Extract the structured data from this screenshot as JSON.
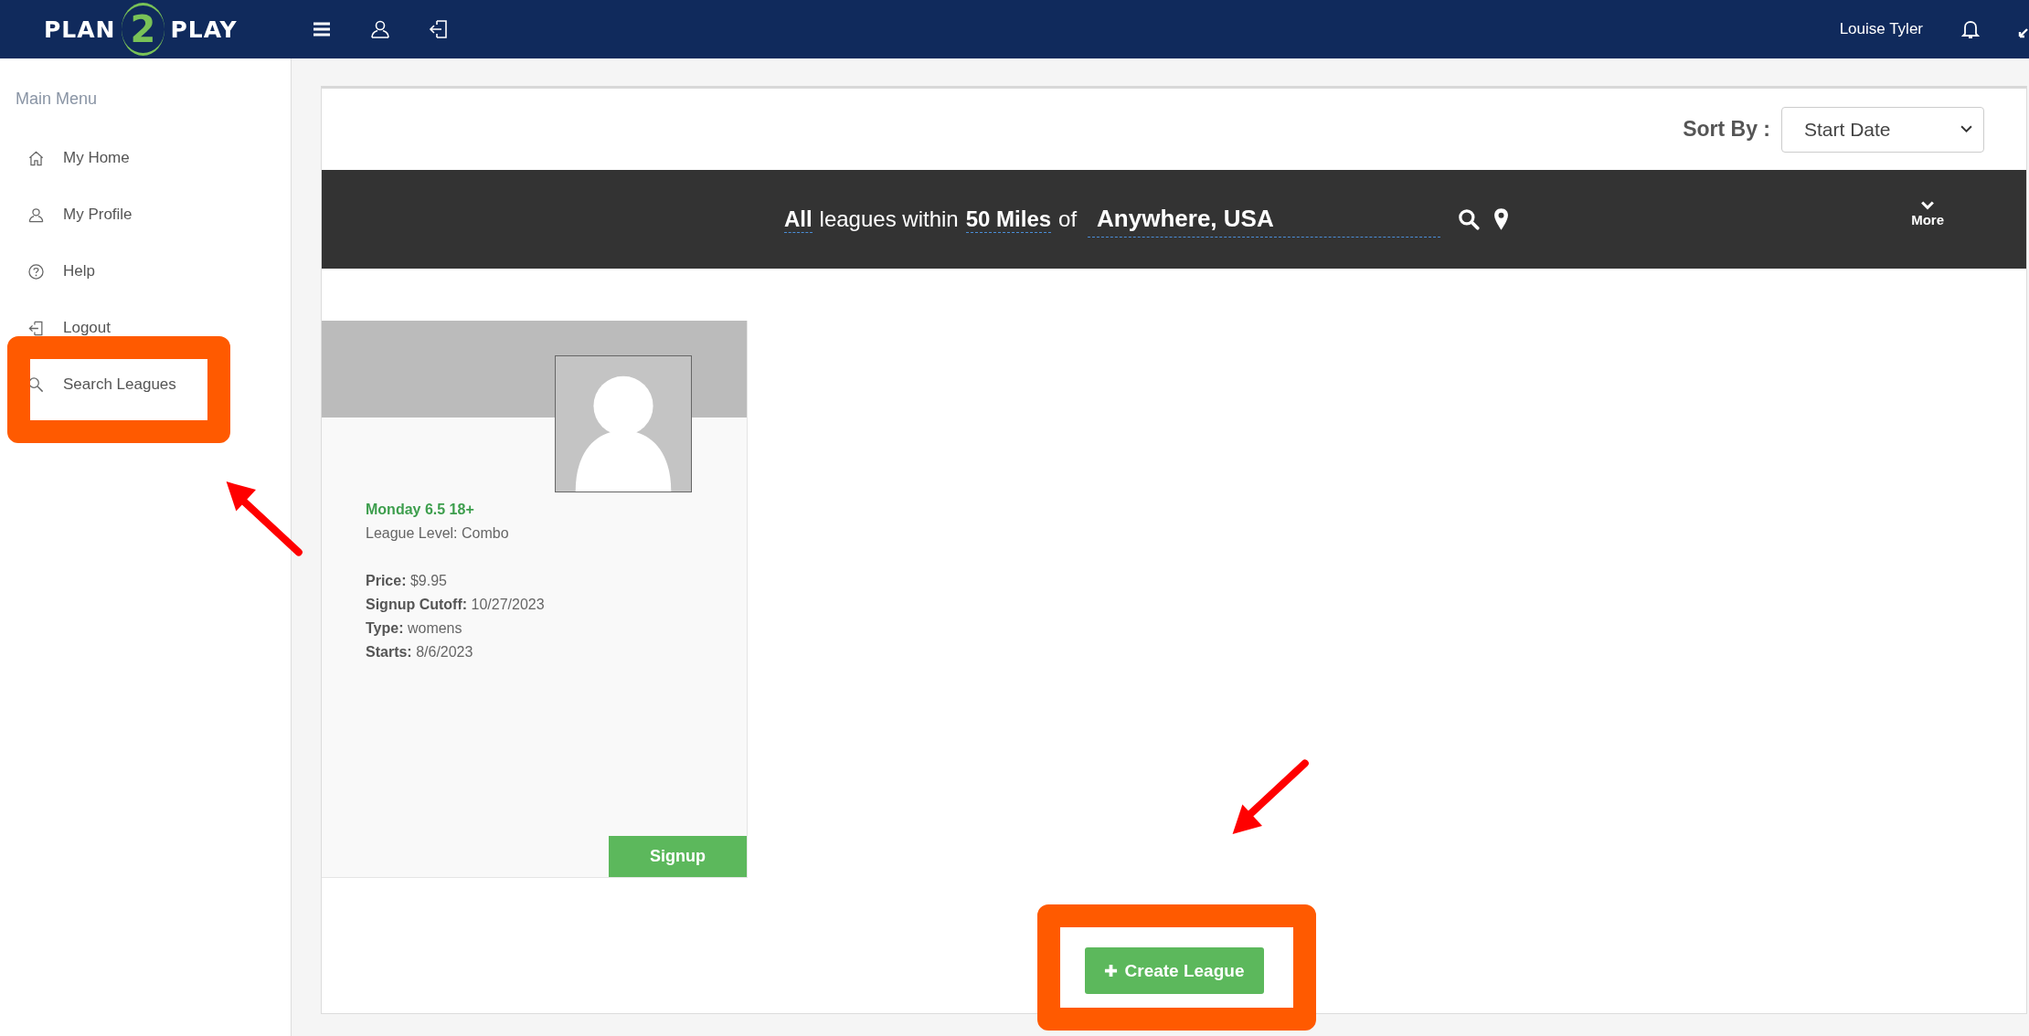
{
  "header": {
    "logo": {
      "left": "PLAN",
      "digit": "2",
      "right": "PLAY"
    },
    "user_name": "Louise Tyler"
  },
  "sidebar": {
    "heading": "Main Menu",
    "items": [
      {
        "label": "My Home",
        "kind": "home"
      },
      {
        "label": "My Profile",
        "kind": "user"
      },
      {
        "label": "Help",
        "kind": "help"
      },
      {
        "label": "Logout",
        "kind": "logout"
      },
      {
        "label": "Search Leagues",
        "kind": "search"
      }
    ]
  },
  "sort": {
    "label": "Sort By :",
    "value": "Start Date"
  },
  "search_bar": {
    "scope": "All",
    "text_1": "leagues within",
    "distance": "50 Miles",
    "text_2": "of",
    "location": "Anywhere, USA",
    "more": "More"
  },
  "leagues": [
    {
      "title": "Monday 6.5 18+",
      "level": "League Level: Combo",
      "details": [
        "**Price:** $9.95",
        "**Signup Cutoff:** 10/27/2023",
        "**Type:** womens",
        "**Starts:** 8/6/2023"
      ],
      "button": "Signup"
    }
  ],
  "create_button": "Create League",
  "annotations": [
    {
      "kind": "highlight"
    },
    {
      "kind": "arrow"
    },
    {
      "kind": "arrow"
    },
    {
      "kind": "highlight"
    }
  ]
}
